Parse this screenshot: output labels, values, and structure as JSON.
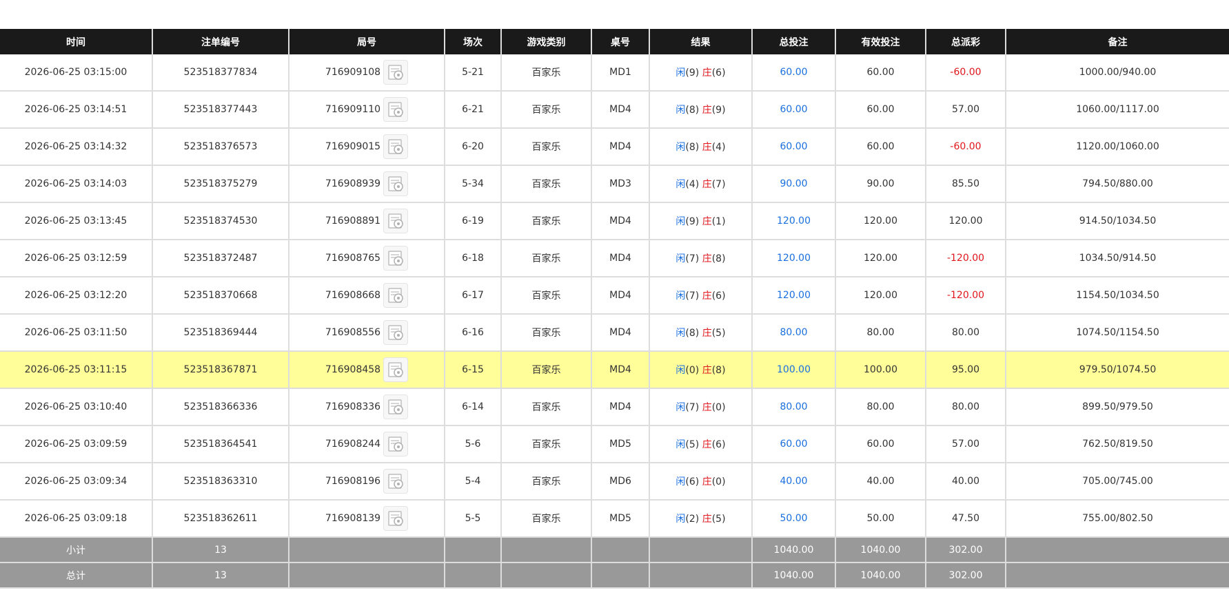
{
  "table": {
    "headers": [
      "时间",
      "注单编号",
      "局号",
      "场次",
      "游戏类别",
      "桌号",
      "结果",
      "总投注",
      "有效投注",
      "总派彩",
      "备注"
    ],
    "rows": [
      {
        "time": "2026-06-25 03:15:00",
        "bet_id": "523518377834",
        "round_no": "716909108",
        "shoe": "5-21",
        "game": "百家乐",
        "table": "MD1",
        "player_label": "闲",
        "player_score": "(9)",
        "banker_label": "庄",
        "banker_score": "(6)",
        "total_bet": "60.00",
        "valid_bet": "60.00",
        "payout": "-60.00",
        "payout_negative": true,
        "remark": "1000.00/940.00"
      },
      {
        "time": "2026-06-25 03:14:51",
        "bet_id": "523518377443",
        "round_no": "716909110",
        "shoe": "6-21",
        "game": "百家乐",
        "table": "MD4",
        "player_label": "闲",
        "player_score": "(8)",
        "banker_label": "庄",
        "banker_score": "(9)",
        "total_bet": "60.00",
        "valid_bet": "60.00",
        "payout": "57.00",
        "payout_negative": false,
        "remark": "1060.00/1117.00"
      },
      {
        "time": "2026-06-25 03:14:32",
        "bet_id": "523518376573",
        "round_no": "716909015",
        "shoe": "6-20",
        "game": "百家乐",
        "table": "MD4",
        "player_label": "闲",
        "player_score": "(8)",
        "banker_label": "庄",
        "banker_score": "(4)",
        "total_bet": "60.00",
        "valid_bet": "60.00",
        "payout": "-60.00",
        "payout_negative": true,
        "remark": "1120.00/1060.00"
      },
      {
        "time": "2026-06-25 03:14:03",
        "bet_id": "523518375279",
        "round_no": "716908939",
        "shoe": "5-34",
        "game": "百家乐",
        "table": "MD3",
        "player_label": "闲",
        "player_score": "(4)",
        "banker_label": "庄",
        "banker_score": "(7)",
        "total_bet": "90.00",
        "valid_bet": "90.00",
        "payout": "85.50",
        "payout_negative": false,
        "remark": "794.50/880.00"
      },
      {
        "time": "2026-06-25 03:13:45",
        "bet_id": "523518374530",
        "round_no": "716908891",
        "shoe": "6-19",
        "game": "百家乐",
        "table": "MD4",
        "player_label": "闲",
        "player_score": "(9)",
        "banker_label": "庄",
        "banker_score": "(1)",
        "total_bet": "120.00",
        "valid_bet": "120.00",
        "payout": "120.00",
        "payout_negative": false,
        "remark": "914.50/1034.50"
      },
      {
        "time": "2026-06-25 03:12:59",
        "bet_id": "523518372487",
        "round_no": "716908765",
        "shoe": "6-18",
        "game": "百家乐",
        "table": "MD4",
        "player_label": "闲",
        "player_score": "(7)",
        "banker_label": "庄",
        "banker_score": "(8)",
        "total_bet": "120.00",
        "valid_bet": "120.00",
        "payout": "-120.00",
        "payout_negative": true,
        "remark": "1034.50/914.50"
      },
      {
        "time": "2026-06-25 03:12:20",
        "bet_id": "523518370668",
        "round_no": "716908668",
        "shoe": "6-17",
        "game": "百家乐",
        "table": "MD4",
        "player_label": "闲",
        "player_score": "(7)",
        "banker_label": "庄",
        "banker_score": "(6)",
        "total_bet": "120.00",
        "valid_bet": "120.00",
        "payout": "-120.00",
        "payout_negative": true,
        "remark": "1154.50/1034.50"
      },
      {
        "time": "2026-06-25 03:11:50",
        "bet_id": "523518369444",
        "round_no": "716908556",
        "shoe": "6-16",
        "game": "百家乐",
        "table": "MD4",
        "player_label": "闲",
        "player_score": "(8)",
        "banker_label": "庄",
        "banker_score": "(5)",
        "total_bet": "80.00",
        "valid_bet": "80.00",
        "payout": "80.00",
        "payout_negative": false,
        "remark": "1074.50/1154.50"
      },
      {
        "time": "2026-06-25 03:11:15",
        "bet_id": "523518367871",
        "round_no": "716908458",
        "shoe": "6-15",
        "game": "百家乐",
        "table": "MD4",
        "player_label": "闲",
        "player_score": "(0)",
        "banker_label": "庄",
        "banker_score": "(8)",
        "total_bet": "100.00",
        "valid_bet": "100.00",
        "payout": "95.00",
        "payout_negative": false,
        "remark": "979.50/1074.50",
        "highlight": true
      },
      {
        "time": "2026-06-25 03:10:40",
        "bet_id": "523518366336",
        "round_no": "716908336",
        "shoe": "6-14",
        "game": "百家乐",
        "table": "MD4",
        "player_label": "闲",
        "player_score": "(7)",
        "banker_label": "庄",
        "banker_score": "(0)",
        "total_bet": "80.00",
        "valid_bet": "80.00",
        "payout": "80.00",
        "payout_negative": false,
        "remark": "899.50/979.50"
      },
      {
        "time": "2026-06-25 03:09:59",
        "bet_id": "523518364541",
        "round_no": "716908244",
        "shoe": "5-6",
        "game": "百家乐",
        "table": "MD5",
        "player_label": "闲",
        "player_score": "(5)",
        "banker_label": "庄",
        "banker_score": "(6)",
        "total_bet": "60.00",
        "valid_bet": "60.00",
        "payout": "57.00",
        "payout_negative": false,
        "remark": "762.50/819.50"
      },
      {
        "time": "2026-06-25 03:09:34",
        "bet_id": "523518363310",
        "round_no": "716908196",
        "shoe": "5-4",
        "game": "百家乐",
        "table": "MD6",
        "player_label": "闲",
        "player_score": "(6)",
        "banker_label": "庄",
        "banker_score": "(0)",
        "total_bet": "40.00",
        "valid_bet": "40.00",
        "payout": "40.00",
        "payout_negative": false,
        "remark": "705.00/745.00"
      },
      {
        "time": "2026-06-25 03:09:18",
        "bet_id": "523518362611",
        "round_no": "716908139",
        "shoe": "5-5",
        "game": "百家乐",
        "table": "MD5",
        "player_label": "闲",
        "player_score": "(2)",
        "banker_label": "庄",
        "banker_score": "(5)",
        "total_bet": "50.00",
        "valid_bet": "50.00",
        "payout": "47.50",
        "payout_negative": false,
        "remark": "755.00/802.50"
      }
    ],
    "subtotal": {
      "label": "小计",
      "count": "13",
      "total_bet": "1040.00",
      "valid_bet": "1040.00",
      "payout": "302.00"
    },
    "total": {
      "label": "总计",
      "count": "13",
      "total_bet": "1040.00",
      "valid_bet": "1040.00",
      "payout": "302.00"
    }
  },
  "icons": {
    "round_video": "video-replay-icon"
  },
  "colors": {
    "header_bg": "#1a1a1a",
    "footer_bg": "#999999",
    "highlight_bg": "#fffe99",
    "player_blue": "#1a6fe0",
    "banker_red": "#e0161b",
    "bet_blue": "#1a6fe0",
    "negative_red": "#e0161b"
  }
}
